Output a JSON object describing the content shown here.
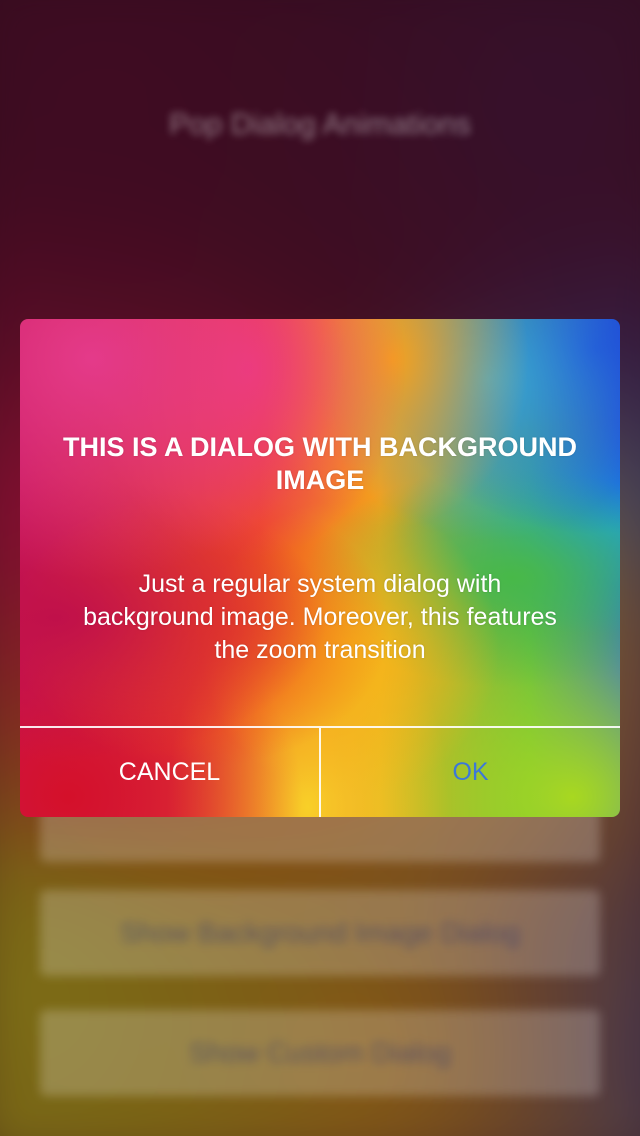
{
  "background": {
    "title": "Pop Dialog Animations",
    "buttons": [
      {
        "label": ""
      },
      {
        "label": "Show Background Image Dialog"
      },
      {
        "label": "Show Custom Dialog"
      }
    ]
  },
  "dialog": {
    "title": "THIS IS A DIALOG WITH BACKGROUND IMAGE",
    "message": "Just a regular system dialog with background image. Moreover, this features the zoom transition",
    "cancel_label": "CANCEL",
    "ok_label": "OK",
    "ok_color": "#3c78d8",
    "cancel_color": "#ffffff"
  }
}
